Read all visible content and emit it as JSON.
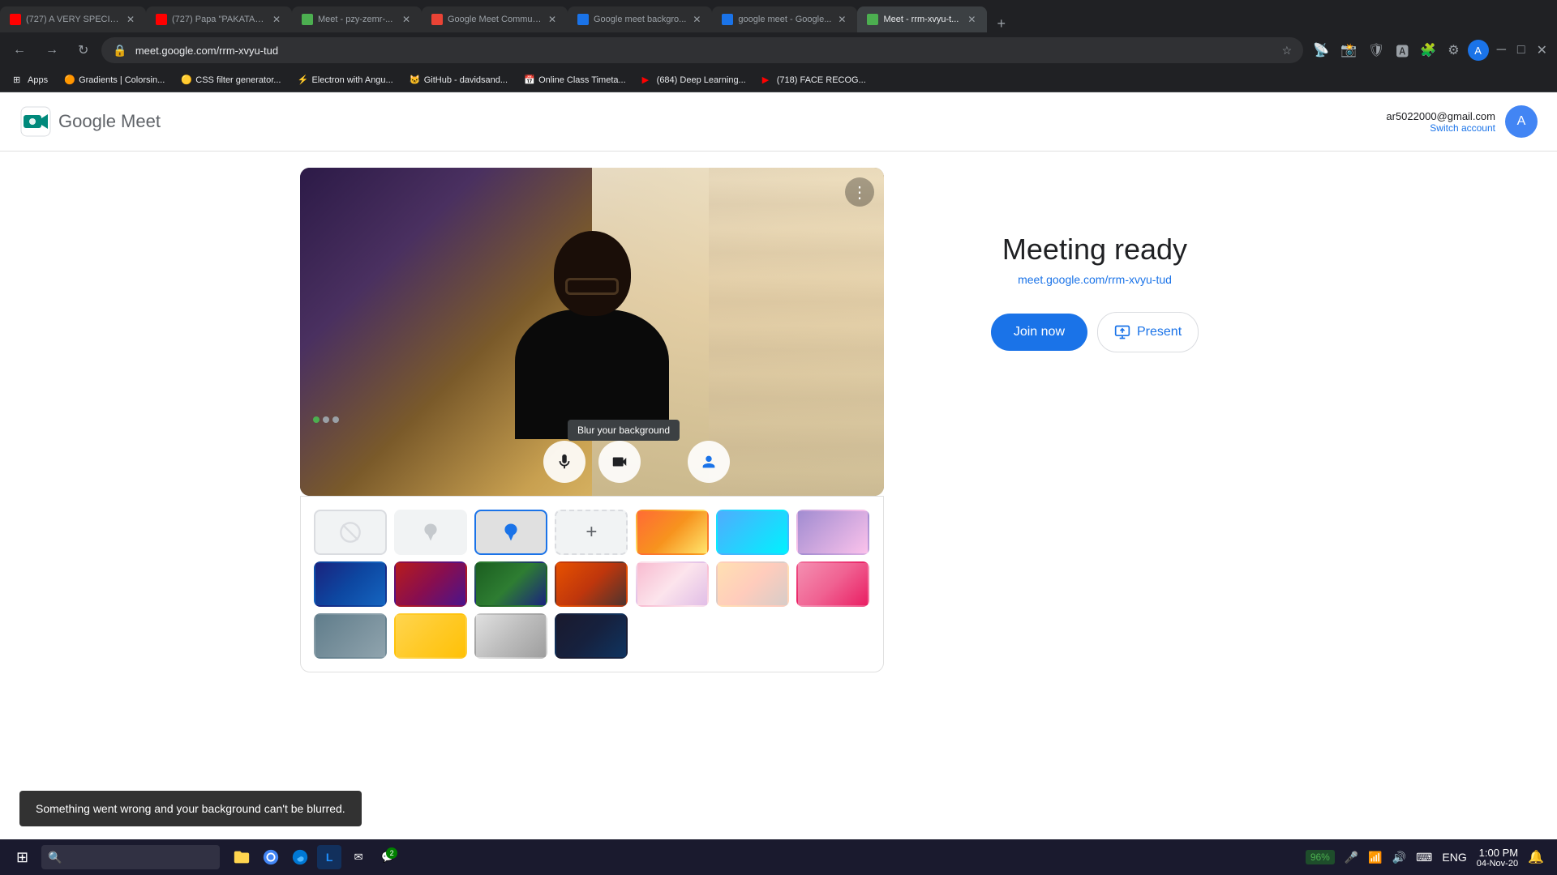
{
  "browser": {
    "tabs": [
      {
        "id": "tab1",
        "favicon_color": "#ff0000",
        "title": "(727) A VERY SPECIAL...",
        "active": false
      },
      {
        "id": "tab2",
        "favicon_color": "#ff0000",
        "title": "(727) Papa \"PAKATA\" b...",
        "active": false
      },
      {
        "id": "tab3",
        "favicon_color": "#4caf50",
        "title": "Meet - pzy-zemr-...",
        "active": false
      },
      {
        "id": "tab4",
        "favicon_color": "#ea4335",
        "title": "Google Meet Commun...",
        "active": false
      },
      {
        "id": "tab5",
        "favicon_color": "#1a73e8",
        "title": "Google meet backgro...",
        "active": false
      },
      {
        "id": "tab6",
        "favicon_color": "#1a73e8",
        "title": "google meet - Google...",
        "active": false
      },
      {
        "id": "tab7",
        "favicon_color": "#4caf50",
        "title": "Meet - rrm-xvyu-t...",
        "active": true
      }
    ],
    "address": "meet.google.com/rrm-xvyu-tud",
    "bookmarks": [
      {
        "id": "bm1",
        "title": "Apps",
        "favicon": "🔷"
      },
      {
        "id": "bm2",
        "title": "Gradients | Colorsin...",
        "favicon": "🟠"
      },
      {
        "id": "bm3",
        "title": "CSS filter generator...",
        "favicon": "🟡"
      },
      {
        "id": "bm4",
        "title": "Electron with Angu...",
        "favicon": "⚡"
      },
      {
        "id": "bm5",
        "title": "GitHub - davidsand...",
        "favicon": "🐱"
      },
      {
        "id": "bm6",
        "title": "Online Class Timeta...",
        "favicon": "📅"
      },
      {
        "id": "bm7",
        "title": "(684) Deep Learning...",
        "favicon": "▶"
      },
      {
        "id": "bm8",
        "title": "(718) FACE RECOG...",
        "favicon": "▶"
      }
    ]
  },
  "header": {
    "logo_text": "Google Meet",
    "account_email": "ar5022000@gmail.com",
    "switch_account_label": "Switch account"
  },
  "video": {
    "three_dots_label": "⋮",
    "blur_tooltip": "Blur your background"
  },
  "controls": {
    "mic_label": "🎤",
    "camera_label": "📷",
    "effects_label": "👤"
  },
  "backgrounds": {
    "row1": [
      {
        "id": "bg-none",
        "type": "none",
        "selected": false
      },
      {
        "id": "bg-blur-light",
        "type": "blur-light",
        "selected": false
      },
      {
        "id": "bg-blur-heavy",
        "type": "blur-heavy",
        "selected": true
      },
      {
        "id": "bg-add",
        "type": "add",
        "selected": false
      },
      {
        "id": "bg-sunset",
        "type": "img",
        "class": "bg-img-1",
        "selected": false
      },
      {
        "id": "bg-beach",
        "type": "img",
        "class": "bg-img-2",
        "selected": false
      },
      {
        "id": "bg-clouds",
        "type": "img",
        "class": "bg-img-3",
        "selected": false
      }
    ],
    "row2": [
      {
        "id": "bg-galaxy",
        "type": "img",
        "class": "bg-img-r1",
        "selected": false
      },
      {
        "id": "bg-nebula",
        "type": "img",
        "class": "bg-img-r2",
        "selected": false
      },
      {
        "id": "bg-forest",
        "type": "img",
        "class": "bg-img-r3",
        "selected": false
      },
      {
        "id": "bg-canyon",
        "type": "img",
        "class": "bg-img-r4",
        "selected": false
      },
      {
        "id": "bg-flowers",
        "type": "img",
        "class": "bg-img-r5",
        "selected": false
      },
      {
        "id": "bg-peach",
        "type": "img",
        "class": "bg-img-r6",
        "selected": false
      },
      {
        "id": "bg-pink",
        "type": "img",
        "class": "bg-img-r7",
        "selected": false
      }
    ],
    "row3": [
      {
        "id": "bg-city1",
        "type": "img",
        "class": "bg-img-b1",
        "selected": false
      },
      {
        "id": "bg-city2",
        "type": "img",
        "class": "bg-img-b2",
        "selected": false
      },
      {
        "id": "bg-city3",
        "type": "img",
        "class": "bg-img-b3",
        "selected": false
      },
      {
        "id": "bg-city4",
        "type": "img",
        "class": "bg-img-b4",
        "selected": false
      }
    ]
  },
  "meeting": {
    "ready_title": "Meeting ready",
    "url": "meet.google.com/rrm-xvyu-tud",
    "join_now_label": "Join now",
    "present_label": "Present"
  },
  "snackbar": {
    "message": "Something went wrong and your background can't be blurred."
  },
  "taskbar": {
    "start_icon": "⊞",
    "search_placeholder": "🔍",
    "time": "1:00 PM",
    "date": "04-Nov-20",
    "battery": "96%",
    "lang": "ENG",
    "notification_icon": "🔔"
  }
}
